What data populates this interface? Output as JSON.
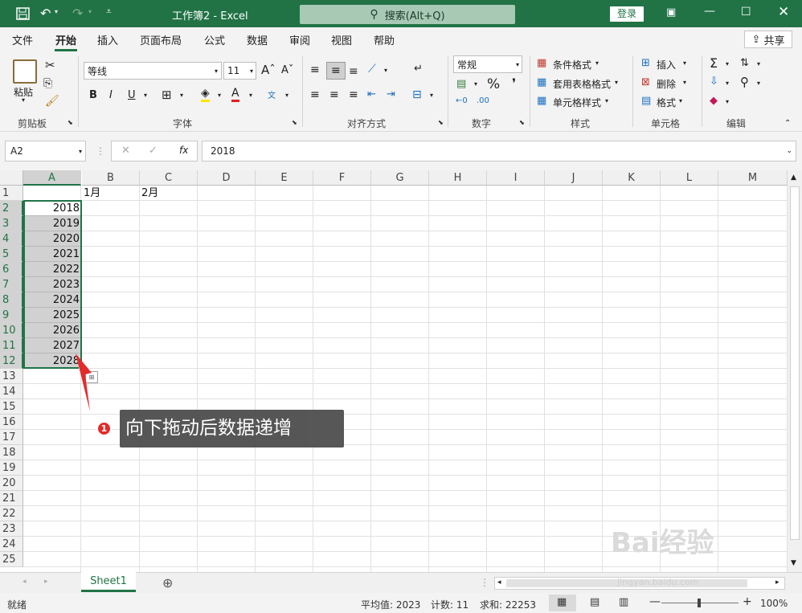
{
  "title_bar": {
    "title": "工作簿2  -  Excel",
    "search": "搜索(Alt+Q)",
    "login": "登录"
  },
  "menu": [
    "文件",
    "开始",
    "插入",
    "页面布局",
    "公式",
    "数据",
    "审阅",
    "视图",
    "帮助"
  ],
  "share": "共享",
  "ribbon": {
    "clipboard": {
      "paste": "粘贴",
      "group": "剪贴板"
    },
    "font": {
      "name": "等线",
      "size": "11",
      "group": "字体"
    },
    "alignment": {
      "group": "对齐方式"
    },
    "number": {
      "format": "常规",
      "group": "数字"
    },
    "styles": {
      "conditional": "条件格式",
      "table": "套用表格格式",
      "cell": "单元格样式",
      "group": "样式"
    },
    "cells": {
      "insert": "插入",
      "delete": "删除",
      "format": "格式",
      "group": "单元格"
    },
    "editing": {
      "group": "编辑"
    }
  },
  "formula_bar": {
    "name_box": "A2",
    "value": "2018",
    "fx": "fx"
  },
  "columns": [
    "A",
    "B",
    "C",
    "D",
    "E",
    "F",
    "G",
    "H",
    "I",
    "J",
    "K",
    "L",
    "M"
  ],
  "rows": [
    "1",
    "2",
    "3",
    "4",
    "5",
    "6",
    "7",
    "8",
    "9",
    "10",
    "11",
    "12",
    "13",
    "14",
    "15",
    "16",
    "17",
    "18",
    "19",
    "20",
    "21",
    "22",
    "23",
    "24",
    "25"
  ],
  "cells": {
    "B1": "1月",
    "C1": "2月",
    "A_values": [
      "2018",
      "2019",
      "2020",
      "2021",
      "2022",
      "2023",
      "2024",
      "2025",
      "2026",
      "2027",
      "2028"
    ]
  },
  "sheet": {
    "tab": "Sheet1"
  },
  "status": {
    "ready": "就绪",
    "average": "平均值: 2023",
    "count": "计数: 11",
    "sum": "求和: 22253",
    "zoom": "100%"
  },
  "annotation": {
    "number": "1",
    "text": "向下拖动后数据递增"
  },
  "watermark": {
    "brand": "Bai经验",
    "url": "jingyan.baidu.com"
  },
  "colors": {
    "accent": "#217346",
    "callout": "#4e4e4e",
    "badge": "#e32b2b"
  }
}
